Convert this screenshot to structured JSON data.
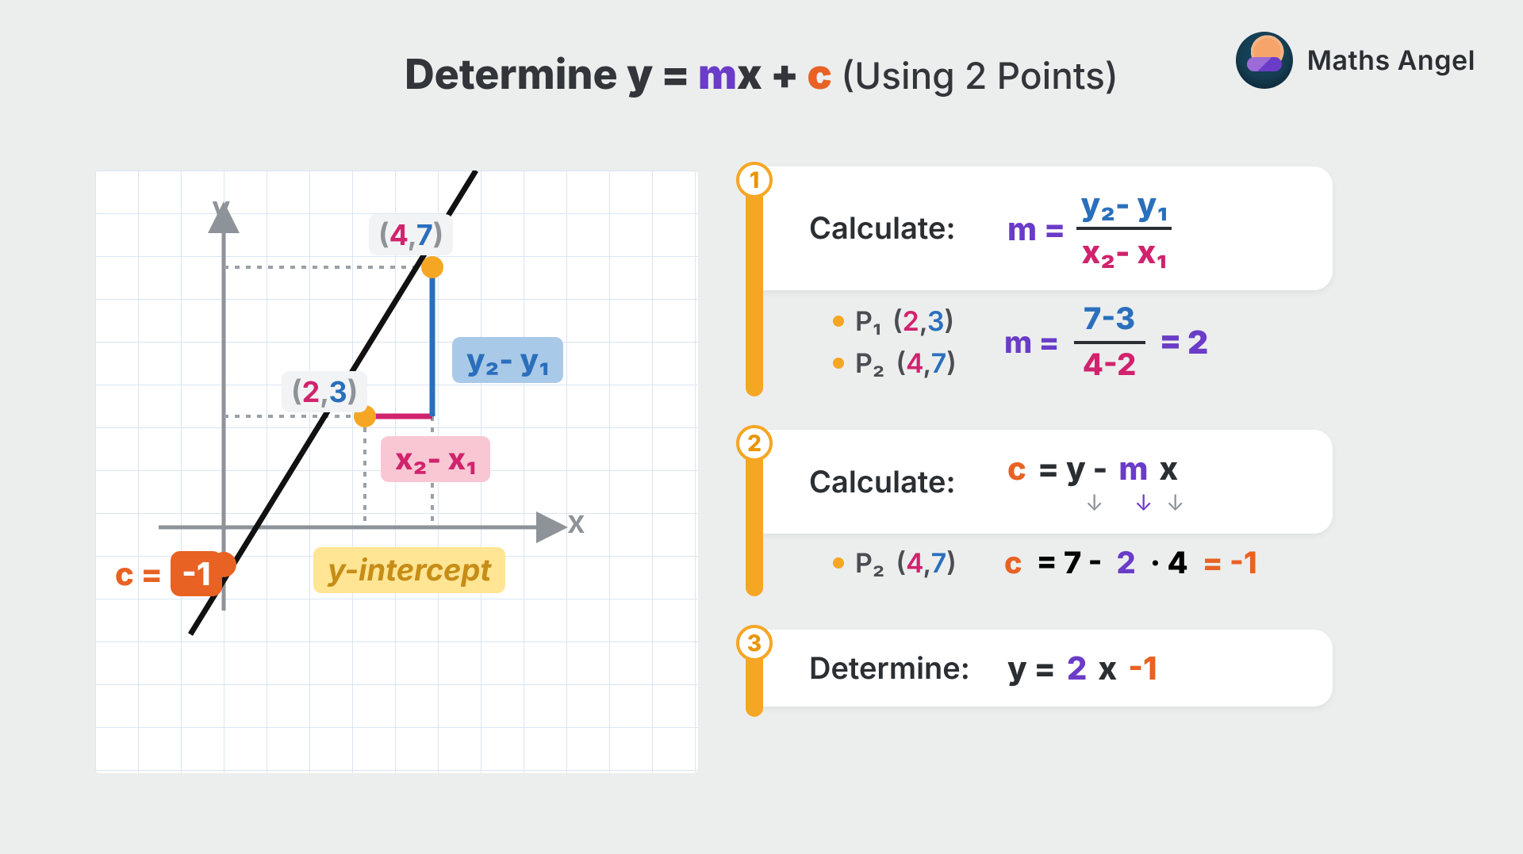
{
  "brand": "Maths Angel",
  "title": {
    "prefix": "Determine ",
    "eq_y": "y = ",
    "eq_m": "m",
    "eq_x": "x + ",
    "eq_c": "c",
    "suffix": " (Using 2 Points)"
  },
  "graph": {
    "p1": {
      "label_open": "(",
      "x": "2",
      "sep": ",",
      "y": "3",
      "label_close": ")"
    },
    "p2": {
      "label_open": "(",
      "x": "4",
      "sep": ",",
      "y": "7",
      "label_close": ")"
    },
    "dy_label": "y₂- y₁",
    "dx_label": "x₂- x₁",
    "axis_x": "x",
    "axis_y": "y",
    "yint_label": "y-intercept",
    "c_equals_text": "c =",
    "c_value": "-1"
  },
  "step1": {
    "num": "1",
    "lede": "Calculate:",
    "m_eq": "m =",
    "frac_top": "y₂- y₁",
    "frac_bot": "x₂- x₁",
    "p1_name": "P₁",
    "p1_pair_x": "2",
    "p1_pair_y": "3",
    "p2_name": "P₂",
    "p2_pair_x": "4",
    "p2_pair_y": "7",
    "sub_m_eq": "m =",
    "sub_top": "7-3",
    "sub_bot": "4-2",
    "result": "= 2"
  },
  "step2": {
    "num": "2",
    "lede": "Calculate:",
    "eq_c": "c",
    "eq_mid": " = y - ",
    "eq_m": "m",
    "eq_x": "x",
    "p2_name": "P₂",
    "p2_pair_x": "4",
    "p2_pair_y": "7",
    "calc_c": "c",
    "calc_mid": " = 7 - ",
    "calc_m": "2",
    "calc_dot": " · 4 ",
    "calc_res": " = -1"
  },
  "step3": {
    "num": "3",
    "lede": "Determine:",
    "eq_y": "y = ",
    "eq_m": "2",
    "eq_x": "x ",
    "eq_c": "-1"
  }
}
